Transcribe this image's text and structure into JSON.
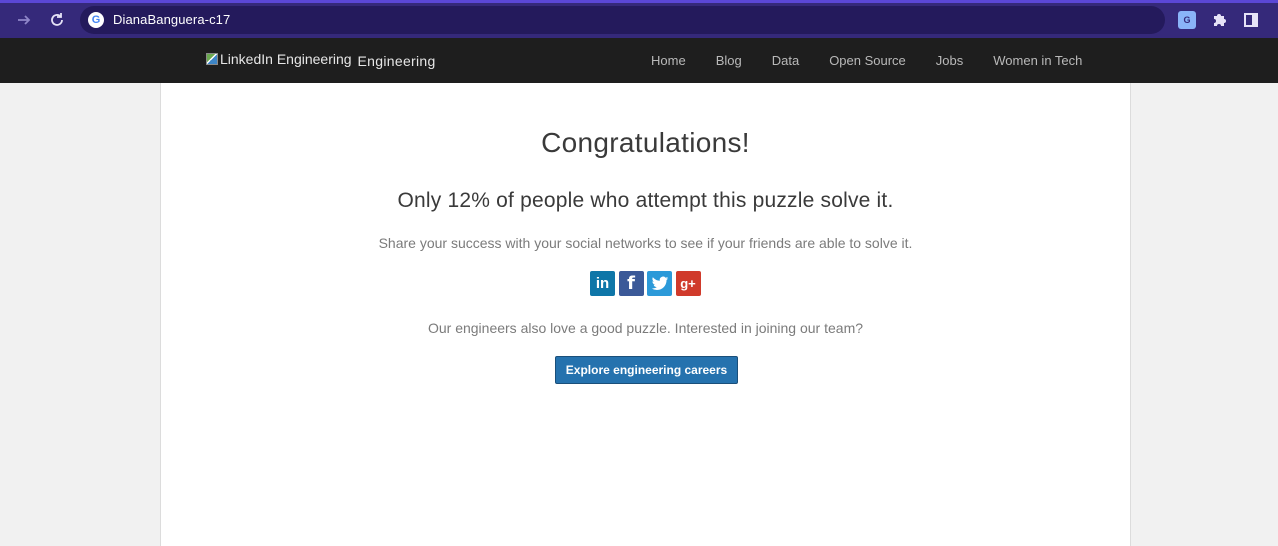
{
  "browser": {
    "url": "DianaBanguera-c17",
    "forward_icon": "arrow-right-icon",
    "reload_icon": "reload-icon"
  },
  "header": {
    "logo_alt": "LinkedIn Engineering",
    "brand_name": "Engineering",
    "nav": [
      "Home",
      "Blog",
      "Data",
      "Open Source",
      "Jobs",
      "Women in Tech"
    ]
  },
  "main": {
    "title": "Congratulations!",
    "stat": "Only 12% of people who attempt this puzzle solve it.",
    "share_prompt": "Share your success with your social networks to see if your friends are able to solve it.",
    "social": {
      "linkedin": "in",
      "facebook": "f",
      "gplus": "g+"
    },
    "engineers_prompt": "Our engineers also love a good puzzle. Interested in joining our team?",
    "careers_button": "Explore engineering careers"
  },
  "colors": {
    "chrome": "#35297a",
    "header_bg": "#1e1e1e",
    "button": "#2572ae"
  }
}
